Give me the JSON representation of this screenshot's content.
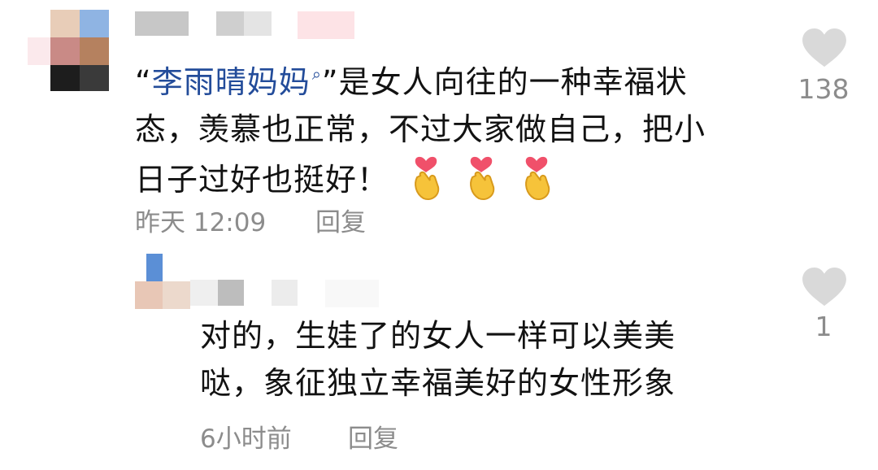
{
  "comments": [
    {
      "mention": "李雨晴妈妈",
      "mention_prefix": "“",
      "mention_suffix": "”",
      "line1_rest": "是女人向往的一种幸福状",
      "line2": "态，羡慕也正常，不过大家做自己，把小",
      "line3": "日子过好也挺好！",
      "emoji_count": 3,
      "emoji_icon": "finger-heart-icon",
      "time": "昨天 12:09",
      "reply_label": "回复",
      "like_count": "138"
    },
    {
      "line1": "对的，生娃了的女人一样可以美美",
      "line2": "哒，象征独立幸福美好的女性形象",
      "time": "6小时前",
      "reply_label": "回复",
      "like_count": "1"
    }
  ],
  "colors": {
    "mention": "#234c9a",
    "meta": "#8c8c8c",
    "heart": "#d9d9d9"
  }
}
